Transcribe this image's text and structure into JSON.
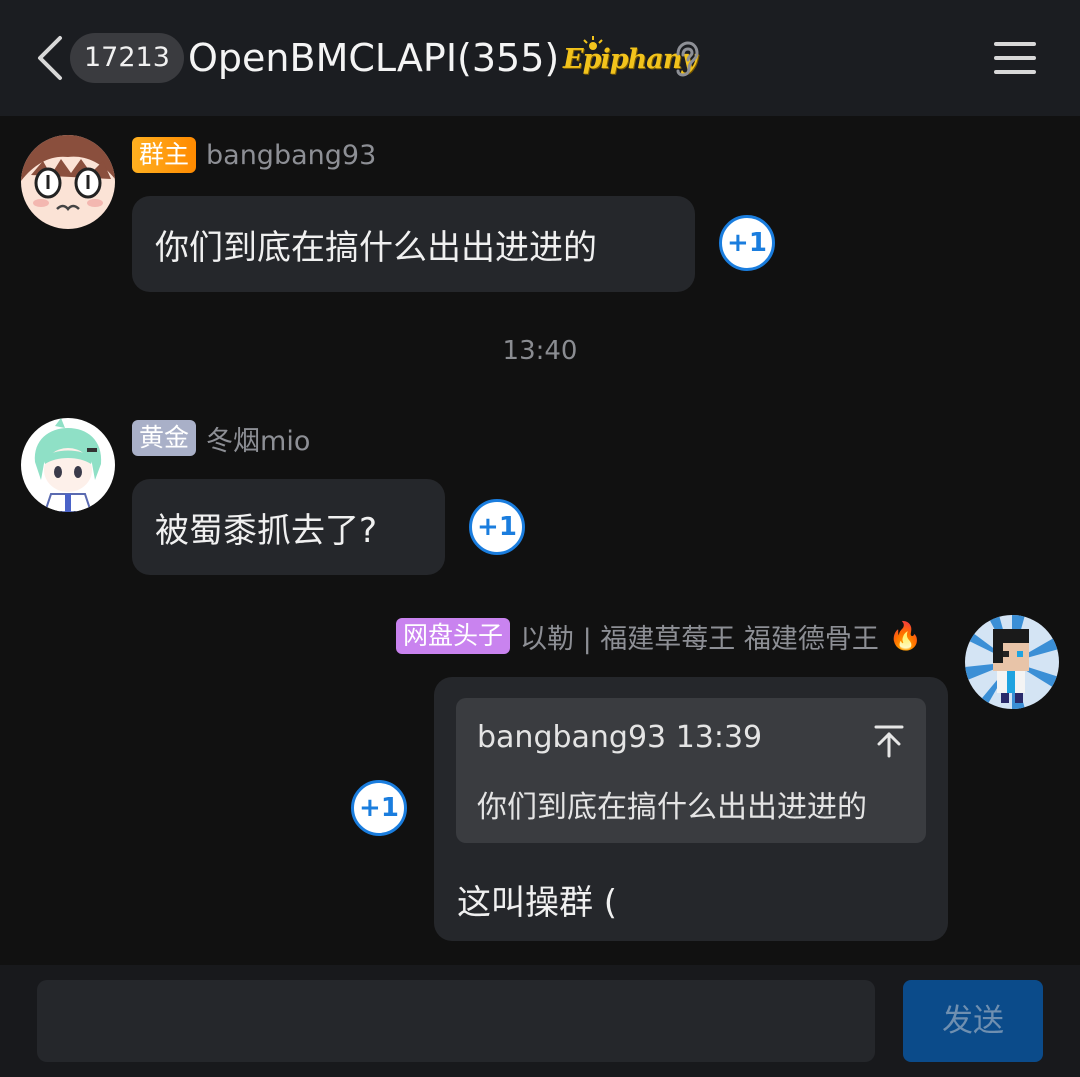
{
  "header": {
    "unread_count": "17213",
    "title": "OpenBMCLAPI(355)",
    "title_badge": "Epiphany",
    "icons": {
      "back": "chevron-left-icon",
      "ear": "ear-icon",
      "menu": "hamburger-menu-icon"
    }
  },
  "messages": [
    {
      "side": "left",
      "tag": "群主",
      "sender": "bangbang93",
      "text": "你们到底在搞什么出出进进的",
      "plus_one": "+1"
    },
    {
      "side": "left",
      "tag": "黄金",
      "sender": "冬烟mio",
      "text": "被蜀黍抓去了?",
      "plus_one": "+1"
    },
    {
      "side": "right",
      "tag": "网盘头子",
      "sender": "以勒 | 福建草莓王 福建德骨王",
      "sender_emoji": "🔥",
      "quote": {
        "sender": "bangbang93",
        "time": "13:39",
        "text": "你们到底在搞什么出出进进的"
      },
      "text": "这叫操群 (",
      "plus_one": "+1"
    }
  ],
  "time_divider": "13:40",
  "input": {
    "value": "",
    "placeholder": ""
  },
  "send_label": "发送",
  "colors": {
    "background": "#111111",
    "header": "#1b1d21",
    "bubble": "#25272b",
    "owner_tag": "#ff9a10",
    "gold_tag": "#a9b0c8",
    "pan_tag": "#c983ef",
    "accent": "#1a7dde",
    "send_button": "#0b4b8a"
  }
}
